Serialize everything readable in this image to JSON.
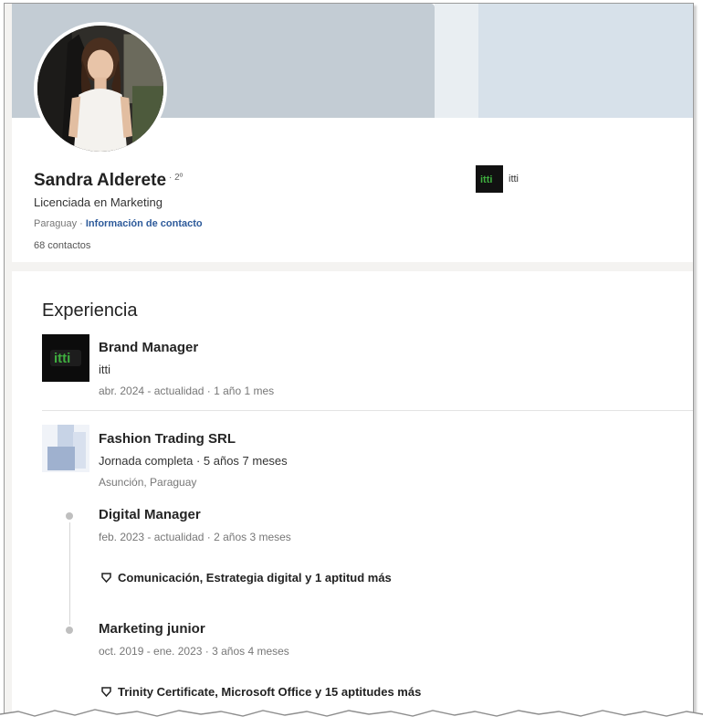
{
  "profile": {
    "name": "Sandra Alderete",
    "degree": "· 2º",
    "headline": "Licenciada en Marketing",
    "location": "Paraguay",
    "location_separator": " · ",
    "contact_link": "Información de contacto",
    "connections": "68 contactos",
    "current_company": "itti"
  },
  "experience": {
    "title": "Experiencia",
    "jobs": [
      {
        "title": "Brand Manager",
        "company": "itti",
        "dates": "abr. 2024 - actualidad · 1 año 1 mes"
      },
      {
        "company": "Fashion Trading SRL",
        "employment": "Jornada completa · 5 años 7 meses",
        "location": "Asunción, Paraguay",
        "roles": [
          {
            "title": "Digital Manager",
            "dates": "feb. 2023 - actualidad · 2 años 3 meses",
            "skills": "Comunicación, Estrategia digital y 1 aptitud más"
          },
          {
            "title": "Marketing junior",
            "dates": "oct. 2019 - ene. 2023 · 3 años 4 meses",
            "skills": "Trinity Certificate, Microsoft Office y 15 aptitudes más"
          }
        ]
      }
    ]
  },
  "logos": {
    "itti_logo_text": "itti",
    "itti_logo_color": "#3fae3f"
  }
}
